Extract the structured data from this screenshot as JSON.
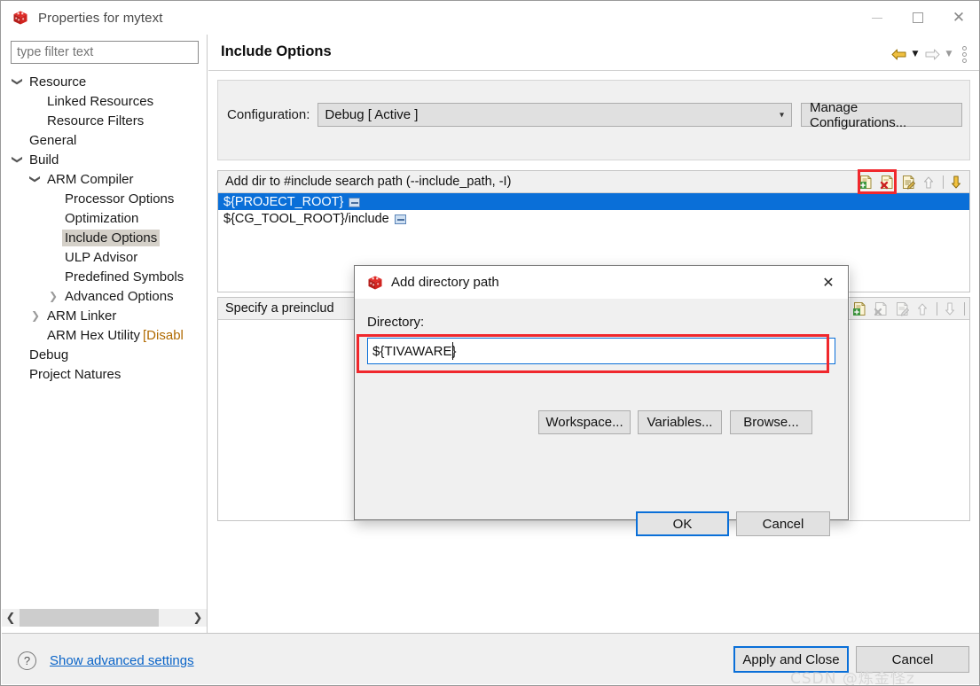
{
  "window": {
    "title": "Properties for mytext",
    "app_icon": "ccs-cube-icon",
    "controls": {
      "minimize": "minimize-icon",
      "maximize": "maximize-icon",
      "close": "close-icon"
    }
  },
  "sidebar": {
    "filter": {
      "placeholder": "type filter text",
      "value": ""
    },
    "items": [
      {
        "label": "Resource",
        "indent": 0,
        "twisty": "expanded",
        "selected": false
      },
      {
        "label": "Linked Resources",
        "indent": 1,
        "twisty": "none",
        "selected": false
      },
      {
        "label": "Resource Filters",
        "indent": 1,
        "twisty": "none",
        "selected": false
      },
      {
        "label": "General",
        "indent": 0,
        "twisty": "none",
        "selected": false
      },
      {
        "label": "Build",
        "indent": 0,
        "twisty": "expanded",
        "selected": false
      },
      {
        "label": "ARM Compiler",
        "indent": 1,
        "twisty": "expanded",
        "selected": false
      },
      {
        "label": "Processor Options",
        "indent": 2,
        "twisty": "none",
        "selected": false
      },
      {
        "label": "Optimization",
        "indent": 2,
        "twisty": "none",
        "selected": false
      },
      {
        "label": "Include Options",
        "indent": 2,
        "twisty": "none",
        "selected": true
      },
      {
        "label": "ULP Advisor",
        "indent": 2,
        "twisty": "none",
        "selected": false
      },
      {
        "label": "Predefined Symbols",
        "indent": 2,
        "twisty": "none",
        "selected": false
      },
      {
        "label": "Advanced Options",
        "indent": 2,
        "twisty": "collapsed",
        "selected": false
      },
      {
        "label": "ARM Linker",
        "indent": 1,
        "twisty": "collapsed",
        "selected": false
      },
      {
        "label": "ARM Hex Utility",
        "indent": 1,
        "twisty": "none",
        "selected": false,
        "suffix": "[Disabl"
      },
      {
        "label": "Debug",
        "indent": 0,
        "twisty": "none",
        "selected": false
      },
      {
        "label": "Project Natures",
        "indent": 0,
        "twisty": "none",
        "selected": false
      }
    ],
    "scrollbar": {
      "left_arrow": "chevron-left-icon",
      "right_arrow": "chevron-right-icon"
    }
  },
  "page": {
    "title": "Include Options",
    "nav": {
      "back": "back-arrow-icon",
      "back_menu": "chevron-down-icon",
      "forward": "forward-arrow-icon",
      "forward_menu": "chevron-down-icon",
      "view_menu": "vertical-dots-icon"
    },
    "configuration": {
      "label": "Configuration:",
      "value": "Debug  [ Active ]",
      "manage_button": "Manage Configurations..."
    },
    "include_list": {
      "header": "Add dir to #include search path (--include_path, -I)",
      "rows": [
        {
          "text": "${PROJECT_ROOT}",
          "variable_badge": true,
          "selected": true
        },
        {
          "text": "${CG_TOOL_ROOT}/include",
          "variable_badge": true,
          "selected": false
        }
      ],
      "toolbar": [
        {
          "name": "add-icon",
          "enabled": true
        },
        {
          "name": "delete-icon",
          "enabled": true
        },
        {
          "name": "edit-icon",
          "enabled": true
        },
        {
          "name": "move-up-icon",
          "enabled": false
        },
        {
          "name": "move-down-icon",
          "enabled": true
        }
      ]
    },
    "preinclude_list": {
      "header": "Specify a preinclud",
      "toolbar": [
        {
          "name": "add-icon",
          "enabled": true
        },
        {
          "name": "delete-icon",
          "enabled": false
        },
        {
          "name": "edit-icon",
          "enabled": false
        },
        {
          "name": "move-up-icon",
          "enabled": false
        },
        {
          "name": "move-down-icon",
          "enabled": false
        }
      ]
    }
  },
  "dialog": {
    "title": "Add directory path",
    "icon": "ccs-cube-icon",
    "close": "close-icon",
    "directory_label": "Directory:",
    "directory_value": "${TIVAWARE}",
    "buttons": {
      "workspace": "Workspace...",
      "variables": "Variables...",
      "browse": "Browse...",
      "ok": "OK",
      "cancel": "Cancel"
    }
  },
  "footer": {
    "help_icon": "help-icon",
    "advanced_link": "Show advanced settings",
    "apply_and_close": "Apply and Close",
    "cancel": "Cancel"
  },
  "watermark": "CSDN @炼金怪z",
  "colors": {
    "selection_blue": "#0a6fd8",
    "annotation_red": "#f0282d",
    "link_blue": "#0a64c8",
    "panel_gray": "#f0f0f0",
    "tree_selection": "#d4d0c8"
  }
}
